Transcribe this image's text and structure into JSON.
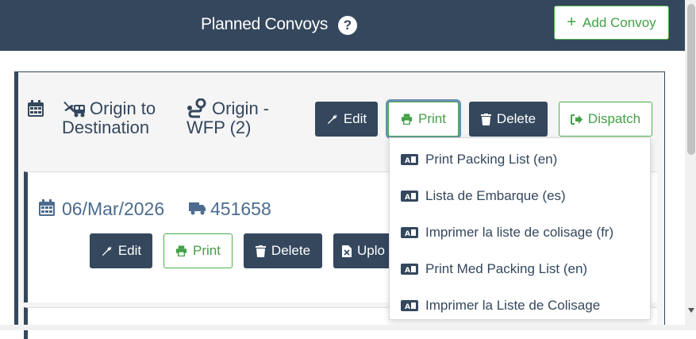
{
  "header": {
    "title": "Planned Convoys",
    "help_icon": "?",
    "add_button_label": "Add Convoy",
    "add_button_icon": "+"
  },
  "convoy": {
    "route": [
      "Origin to",
      "Destination"
    ],
    "origin": [
      "Origin -",
      "WFP (2)"
    ],
    "edit_label": "Edit",
    "print_label": "Print",
    "delete_label": "Delete",
    "dispatch_label": "Dispatch"
  },
  "shipment": {
    "date": "06/Mar/2026",
    "number": "451658",
    "edit_label": "Edit",
    "print_label": "Print",
    "delete_label": "Delete",
    "upload_label": "Uplo"
  },
  "print_menu": {
    "items": [
      "Print Packing List (en)",
      "Lista de Embarque (es)",
      "Imprimer la liste de colisage (fr)",
      "Print Med Packing List (en)",
      "Imprimer la Liste de Colisage"
    ]
  },
  "colors": {
    "header_bg": "#34475d",
    "accent_green": "#43a047",
    "dark_button": "#34475d",
    "link_blue": "#4c6b8e"
  }
}
